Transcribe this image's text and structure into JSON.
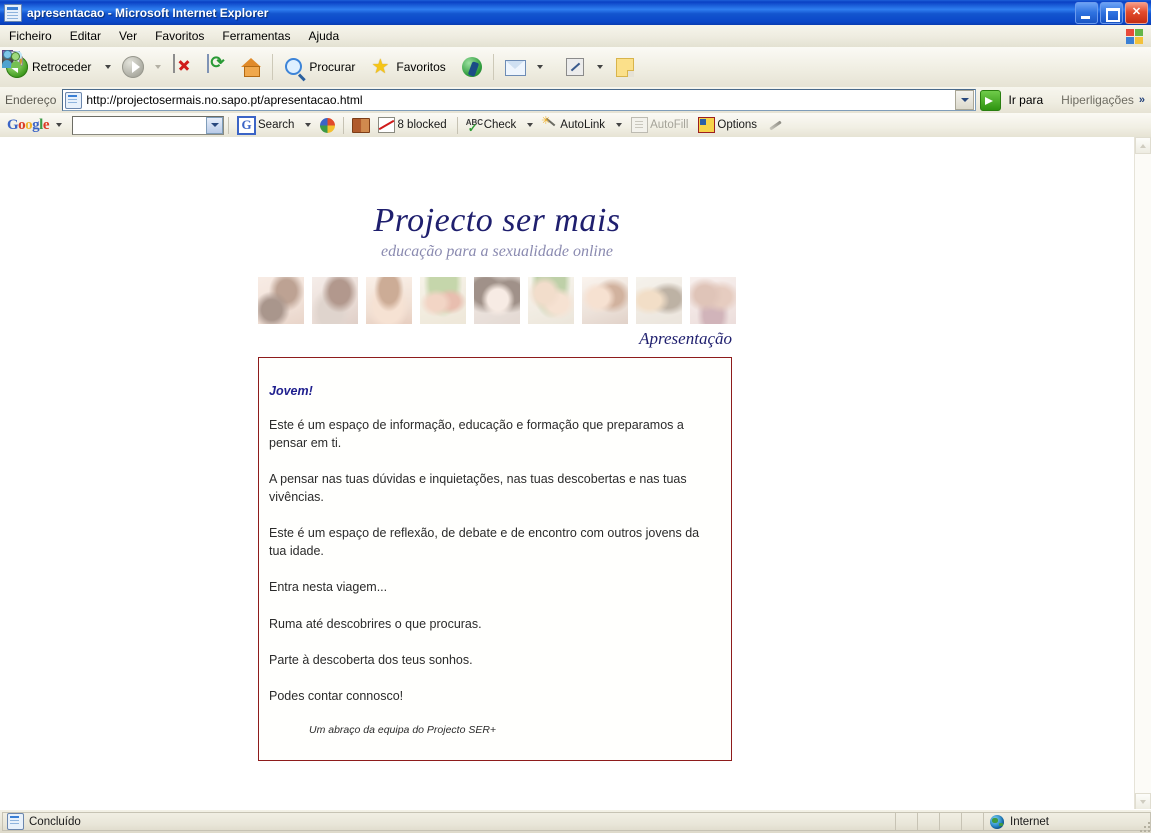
{
  "window": {
    "title": "apresentacao - Microsoft Internet Explorer",
    "icon": "page-icon",
    "minimize_label": "Minimizar",
    "maximize_label": "Maximizar",
    "close_label": "Fechar"
  },
  "menubar": {
    "items": [
      {
        "label": "Ficheiro"
      },
      {
        "label": "Editar"
      },
      {
        "label": "Ver"
      },
      {
        "label": "Favoritos"
      },
      {
        "label": "Ferramentas"
      },
      {
        "label": "Ajuda"
      }
    ]
  },
  "toolbar": {
    "back_label": "Retroceder",
    "forward_label": "",
    "stop_label": "",
    "refresh_label": "",
    "home_label": "",
    "search_label": "Procurar",
    "favorites_label": "Favoritos",
    "media_label": "",
    "mail_label": "",
    "print_label": "",
    "edit_label": "",
    "notes_label": "",
    "research_label": "",
    "messenger_label": "",
    "people_label": ""
  },
  "address": {
    "label": "Endereço",
    "url": "http://projectosermais.no.sapo.pt/apresentacao.html",
    "go_label": "Ir para",
    "links_label": "Hiperligações",
    "chevron": "»"
  },
  "google_toolbar": {
    "logo": {
      "g1": "G",
      "o1": "o",
      "o2": "o",
      "g2": "g",
      "l": "l",
      "e": "e"
    },
    "search_value": "",
    "search_label": "Search",
    "blocked_label": "8 blocked",
    "check_label": "Check",
    "autolink_label": "AutoLink",
    "autofill_label": "AutoFill",
    "options_label": "Options"
  },
  "page": {
    "site_title": "Projecto ser mais",
    "site_subtitle": "educação para a sexualidade online",
    "section_label": "Apresentação",
    "thumbnails": [
      {
        "alt": "casal-abraco"
      },
      {
        "alt": "rapaz-pensativo"
      },
      {
        "alt": "rapaz-retrato"
      },
      {
        "alt": "duas-raparigas"
      },
      {
        "alt": "rapariga-retrato"
      },
      {
        "alt": "casal-sorridente"
      },
      {
        "alt": "duas-amigas"
      },
      {
        "alt": "casal-espelho"
      },
      {
        "alt": "grupo-jovens"
      }
    ],
    "heading": "Jovem!",
    "paragraphs": [
      "Este é um espaço de informação, educação e formação que preparamos a pensar em ti.",
      "A pensar nas tuas dúvidas e inquietações, nas tuas descobertas e nas tuas vivências.",
      "Este é um espaço de reflexão, de debate e de encontro com outros jovens da tua idade.",
      "Entra nesta viagem...",
      "Ruma até descobrires o que procuras.",
      "Parte à descoberta dos teus sonhos.",
      "Podes contar connosco!"
    ],
    "signature": "Um abraço da equipa do Projecto SER+"
  },
  "statusbar": {
    "status_text": "Concluído",
    "zone_text": "Internet"
  },
  "colors": {
    "titlebar_blue": "#0a41c4",
    "panel_border": "#8e1c1c",
    "site_title": "#1f1f6e",
    "site_subtitle": "#8a8ab0",
    "heading": "#1f1f8e",
    "body_text": "#2b2b2b"
  }
}
